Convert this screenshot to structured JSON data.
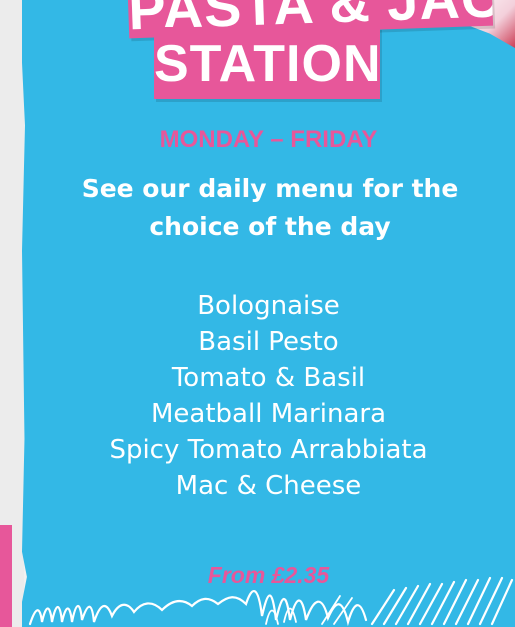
{
  "title": {
    "line1": "PASTA & JACKET",
    "line2": "STATION"
  },
  "days": "MONDAY – FRIDAY",
  "subtitle": {
    "line1": "See our daily menu for the",
    "line2": "choice of the day"
  },
  "menu": {
    "items": [
      "Bolognaise",
      "Basil Pesto",
      "Tomato & Basil",
      "Meatball Marinara",
      "Spicy Tomato Arrabbiata",
      "Mac & Cheese"
    ]
  },
  "price": "From £2.35",
  "colors": {
    "panel": "#33b8e6",
    "accent": "#e7579a",
    "text": "#ffffff"
  }
}
